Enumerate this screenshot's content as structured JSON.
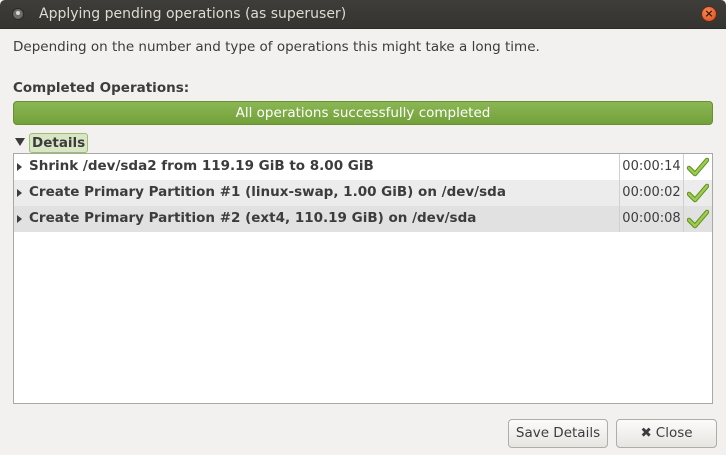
{
  "window": {
    "title": "Applying pending operations (as superuser)",
    "close_glyph": "×"
  },
  "description": "Depending on the number and type of operations this might take a long time.",
  "completed_label": "Completed Operations:",
  "progress": {
    "text": "All operations successfully completed",
    "fraction": 1.0,
    "color": "#7daa45"
  },
  "details": {
    "label": "Details",
    "expanded": true
  },
  "operations": [
    {
      "text": "Shrink /dev/sda2 from 119.19 GiB to 8.00 GiB",
      "time": "00:00:14",
      "status_icon": "check-icon"
    },
    {
      "text": "Create Primary Partition #1 (linux-swap, 1.00 GiB) on /dev/sda",
      "time": "00:00:02",
      "status_icon": "check-icon"
    },
    {
      "text": "Create Primary Partition #2 (ext4, 110.19 GiB) on /dev/sda",
      "time": "00:00:08",
      "status_icon": "check-icon"
    }
  ],
  "buttons": {
    "save": "Save Details",
    "close": "Close",
    "close_glyph": "✖"
  }
}
